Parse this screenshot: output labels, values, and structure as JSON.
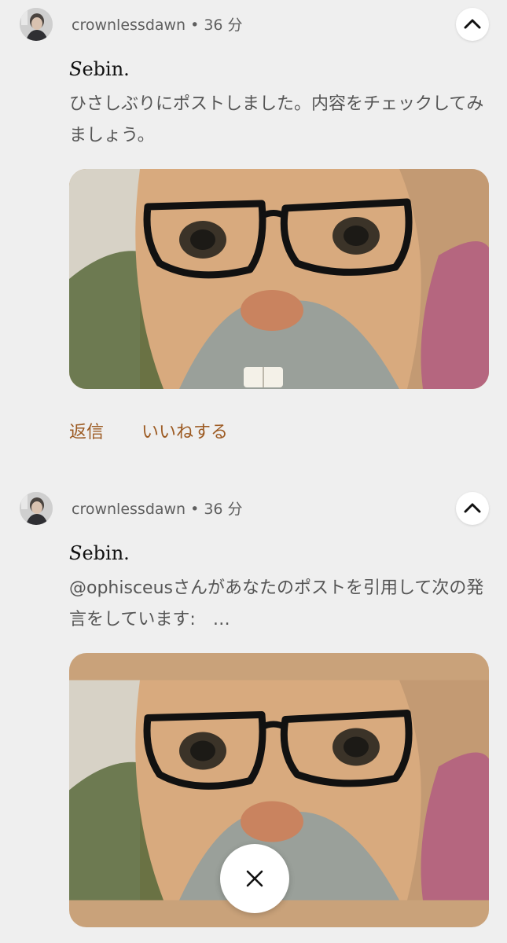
{
  "posts": [
    {
      "username": "crownlessdawn",
      "separator": "•",
      "time": "36 分",
      "author_initial": "S",
      "author_rest": "ebin.",
      "text": "ひさしぶりにポストしました。内容をチェックしてみましょう。",
      "actions": {
        "reply": "返信",
        "like": "いいねする"
      }
    },
    {
      "username": "crownlessdawn",
      "separator": "•",
      "time": "36 分",
      "author_initial": "S",
      "author_rest": "ebin.",
      "text": "@ophisceusさんがあなたのポストを引用して次の発言をしています:　…"
    }
  ],
  "icons": {
    "collapse": "chevron-up-icon",
    "close": "close-icon",
    "media": "cat-with-glasses-image"
  },
  "colors": {
    "background": "#efefef",
    "action_text": "#9c5a22",
    "meta_text": "#5f5f5f"
  }
}
